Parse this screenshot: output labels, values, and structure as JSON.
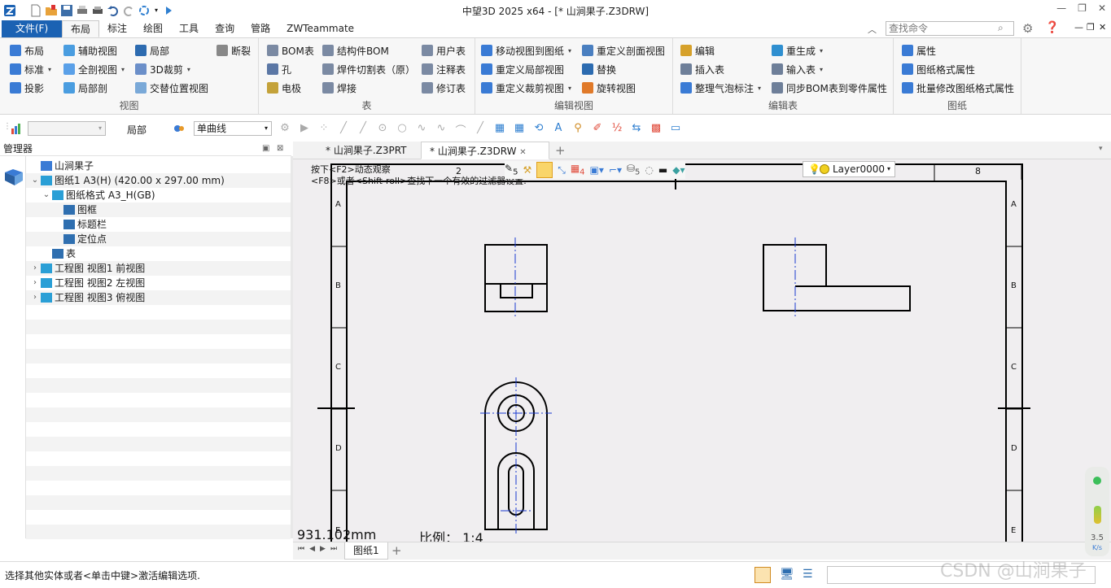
{
  "window": {
    "title": "中望3D 2025 x64 - [* 山涧果子.Z3DRW]"
  },
  "menu": {
    "file": "文件(F)",
    "tabs": [
      "布局",
      "标注",
      "绘图",
      "工具",
      "查询",
      "管路",
      "ZWTeammate"
    ],
    "search_placeholder": "查找命令"
  },
  "ribbon": {
    "view": {
      "title": "视图",
      "items": [
        "布局",
        "辅助视图",
        "局部",
        "断裂",
        "标准",
        "全剖视图",
        "3D裁剪",
        "投影",
        "局部剖",
        "交替位置视图"
      ]
    },
    "table": {
      "title": "表",
      "items": [
        "BOM表",
        "结构件BOM",
        "用户表",
        "孔",
        "焊件切割表（原）",
        "注释表",
        "电极",
        "焊接",
        "修订表"
      ]
    },
    "edit_view": {
      "title": "编辑视图",
      "items": [
        "移动视图到图纸",
        "重定义剖面视图",
        "重定义局部视图",
        "替换",
        "重定义裁剪视图",
        "旋转视图"
      ]
    },
    "edit_table": {
      "title": "编辑表",
      "items": [
        "编辑",
        "重生成",
        "插入表",
        "输入表",
        "整理气泡标注",
        "同步BOM表到零件属性"
      ]
    },
    "sheet": {
      "title": "图纸",
      "items": [
        "属性",
        "图纸格式属性",
        "批量修改图纸格式属性"
      ]
    }
  },
  "toolbar2": {
    "local_label": "局部",
    "curve_select": "单曲线",
    "icons": [
      "pick-gear-icon",
      "play-circle-icon",
      "point-scatter-icon",
      "line-icon",
      "line-2-icon",
      "circle-dot-icon",
      "circle-icon",
      "wave-icon",
      "curve-icon",
      "arc-icon",
      "slash-icon",
      "cube-icon",
      "grid-table-icon",
      "rotate-icon",
      "text-a-icon",
      "pin-icon",
      "marker-icon",
      "fraction-icon",
      "arrow-box-icon",
      "dotted-table-icon",
      "rectangle-icon"
    ]
  },
  "manager": {
    "title": "管理器",
    "tree": [
      {
        "indent": 0,
        "chev": "",
        "icon": "part-root-icon",
        "color": "#3a7bd5",
        "label": "山涧果子"
      },
      {
        "indent": 0,
        "chev": "v",
        "icon": "sheet-icon",
        "color": "#2a9fd6",
        "label": "图纸1 A3(H) (420.00 x 297.00 mm)"
      },
      {
        "indent": 1,
        "chev": "v",
        "icon": "sheet-format-icon",
        "color": "#2a9fd6",
        "label": "图纸格式 A3_H(GB)"
      },
      {
        "indent": 2,
        "chev": "",
        "icon": "frame-icon",
        "color": "#2f6fb0",
        "label": "图框"
      },
      {
        "indent": 2,
        "chev": "",
        "icon": "title-block-icon",
        "color": "#2f6fb0",
        "label": "标题栏"
      },
      {
        "indent": 2,
        "chev": "",
        "icon": "anchor-point-icon",
        "color": "#2f6fb0",
        "label": "定位点"
      },
      {
        "indent": 1,
        "chev": "",
        "icon": "table-icon",
        "color": "#2f6fb0",
        "label": "表"
      },
      {
        "indent": 0,
        "chev": ">",
        "icon": "drawing-view-icon",
        "color": "#2a9fd6",
        "label": "工程图 视图1 前视图"
      },
      {
        "indent": 0,
        "chev": ">",
        "icon": "drawing-view-icon",
        "color": "#2a9fd6",
        "label": "工程图 视图2 左视图"
      },
      {
        "indent": 0,
        "chev": ">",
        "icon": "drawing-view-icon",
        "color": "#2a9fd6",
        "label": "工程图 视图3 俯视图"
      }
    ]
  },
  "documents": [
    "* 山涧果子.Z3PRT",
    "* 山涧果子.Z3DRW"
  ],
  "canvas": {
    "hint1": "按下<F2>动态观察",
    "hint2": "<F8>或者<Shift-roll>查找下一个有效的过滤器设置.",
    "layer": "Layer0000",
    "length": "931.102mm",
    "scale_label": "比例：",
    "scale_value": "1:4",
    "top_labels": [
      "2",
      "8"
    ],
    "row_labels": [
      "A",
      "B",
      "C",
      "D",
      "E"
    ]
  },
  "sheets": [
    "图纸1"
  ],
  "status": {
    "message": "选择其他实体或者<单击中键>激活编辑选项."
  },
  "perf": {
    "value": "3.5",
    "unit": "K/s"
  },
  "watermark": "CSDN @山涧果子"
}
